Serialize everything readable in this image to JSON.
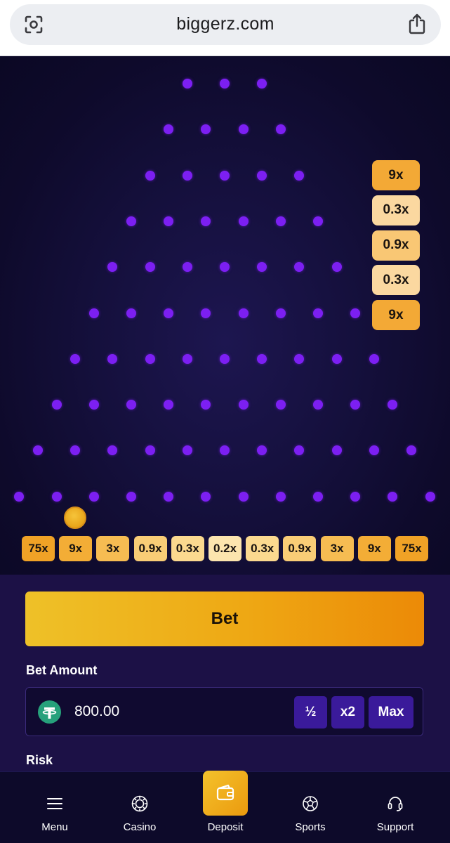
{
  "browser": {
    "url": "biggerz.com"
  },
  "game": {
    "rows": 10,
    "bins": [
      {
        "label": "75x",
        "color": "#f0a226"
      },
      {
        "label": "9x",
        "color": "#f3ad36"
      },
      {
        "label": "3x",
        "color": "#f6bc52"
      },
      {
        "label": "0.9x",
        "color": "#f9cd76"
      },
      {
        "label": "0.3x",
        "color": "#fbd98f"
      },
      {
        "label": "0.2x",
        "color": "#fce5ae"
      },
      {
        "label": "0.3x",
        "color": "#fbd98f"
      },
      {
        "label": "0.9x",
        "color": "#f9cd76"
      },
      {
        "label": "3x",
        "color": "#f6bc52"
      },
      {
        "label": "9x",
        "color": "#f3ad36"
      },
      {
        "label": "75x",
        "color": "#f0a226"
      }
    ],
    "history": [
      {
        "label": "9x",
        "color": "#f3a936"
      },
      {
        "label": "0.3x",
        "color": "#fbd8a0"
      },
      {
        "label": "0.9x",
        "color": "#f9c774"
      },
      {
        "label": "0.3x",
        "color": "#fbd8a0"
      },
      {
        "label": "9x",
        "color": "#f3a936"
      }
    ],
    "peg_color": "#7c1ff2"
  },
  "controls": {
    "bet_button": "Bet",
    "bet_amount_label": "Bet Amount",
    "bet_amount_value": "800.00",
    "half_label": "½",
    "double_label": "x2",
    "max_label": "Max",
    "risk_label": "Risk"
  },
  "nav": {
    "menu": "Menu",
    "casino": "Casino",
    "deposit": "Deposit",
    "sports": "Sports",
    "support": "Support"
  }
}
